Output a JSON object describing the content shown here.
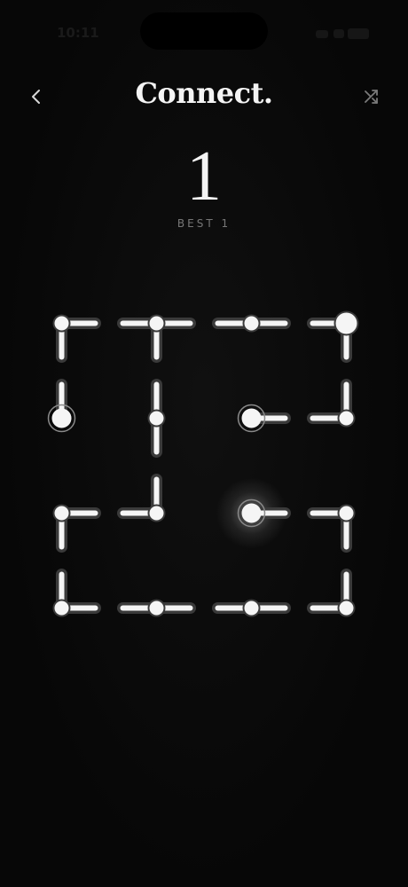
{
  "status": {
    "time": "10:11"
  },
  "header": {
    "title": "Connect."
  },
  "score": {
    "current": "1",
    "best_label": "BEST 1"
  },
  "icons": {
    "back": "chevron-left-icon",
    "shuffle": "shuffle-icon"
  },
  "colors": {
    "background": "#070707",
    "line": "#f5f5f5",
    "line_shadow": "#3a3a3a",
    "endpoint_ring": "#8a8a8a"
  },
  "board": {
    "rows": 4,
    "cols": 4,
    "tiles": [
      {
        "connections": [
          "E",
          "S"
        ],
        "type": "corner"
      },
      {
        "connections": [
          "E",
          "S",
          "W"
        ],
        "type": "tee"
      },
      {
        "connections": [
          "E",
          "W"
        ],
        "type": "straight"
      },
      {
        "connections": [
          "S",
          "W"
        ],
        "type": "corner",
        "endpoint": "big"
      },
      {
        "connections": [
          "N"
        ],
        "type": "end",
        "endpoint": "ring"
      },
      {
        "connections": [
          "N",
          "S"
        ],
        "type": "straight"
      },
      {
        "connections": [
          "E"
        ],
        "type": "end",
        "endpoint": "ring"
      },
      {
        "connections": [
          "N",
          "W"
        ],
        "type": "corner"
      },
      {
        "connections": [
          "E",
          "S"
        ],
        "type": "corner"
      },
      {
        "connections": [
          "N",
          "W"
        ],
        "type": "corner"
      },
      {
        "connections": [
          "E"
        ],
        "type": "end",
        "endpoint": "glow"
      },
      {
        "connections": [
          "S",
          "W"
        ],
        "type": "corner"
      },
      {
        "connections": [
          "N",
          "E"
        ],
        "type": "corner"
      },
      {
        "connections": [
          "E",
          "W"
        ],
        "type": "straight"
      },
      {
        "connections": [
          "E",
          "W"
        ],
        "type": "straight"
      },
      {
        "connections": [
          "N",
          "W"
        ],
        "type": "corner"
      }
    ]
  }
}
